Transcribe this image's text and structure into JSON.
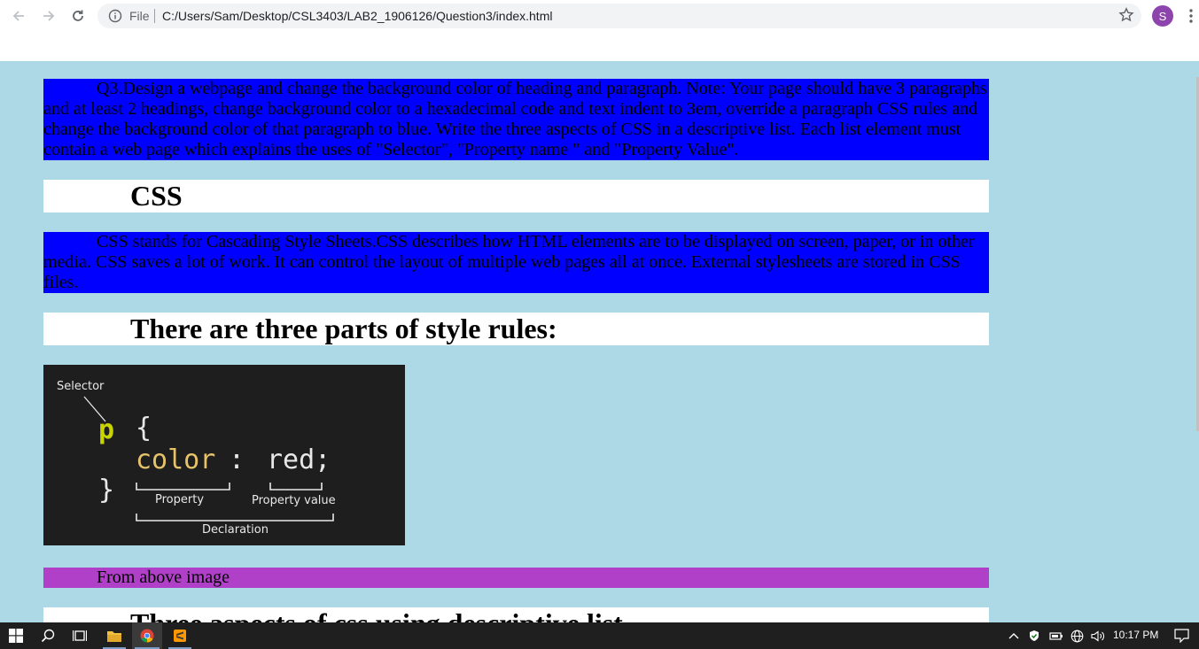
{
  "browser": {
    "scheme_label": "File",
    "url": "C:/Users/Sam/Desktop/CSL3403/LAB2_1906126/Question3/index.html",
    "profile_initial": "S",
    "profile_color": "#8e44ad"
  },
  "page": {
    "background": "#add8e6",
    "question_paragraph": "Q3.Design a webpage and change the background color of heading and paragraph. Note: Your page should have 3 paragraphs and at least 2 headings, change background color to a hexadecimal code and text indent to 3em, override a paragraph CSS rules and change the background color of that paragraph to blue. Write the three aspects of CSS in a descriptive list. Each list element must contain a web page which explains the uses of \"Selector\", \"Property name \" and \"Property Value\".",
    "heading_css": "CSS",
    "css_paragraph": "CSS stands for Cascading Style Sheets.CSS describes how HTML elements are to be displayed on screen, paper, or in other media. CSS saves a lot of work. It can control the layout of multiple web pages all at once. External stylesheets are stored in CSS files.",
    "heading_parts": "There are three parts of style rules:",
    "image": {
      "selector_label": "Selector",
      "code_selector": "p",
      "code_open_brace": "{",
      "code_property": "color",
      "code_colon": ":",
      "code_value": "red;",
      "code_close_brace": "}",
      "property_label": "Property",
      "property_value_label": "Property value",
      "declaration_label": "Declaration"
    },
    "from_above_paragraph": "From above image",
    "heading_aspects": "Three aspects of css using descriptive list"
  },
  "colors": {
    "blue_paragraph": "#0000ff",
    "purple_paragraph": "#b040c8",
    "heading_bg": "#ffffff"
  },
  "taskbar": {
    "time": "10:17 PM"
  }
}
